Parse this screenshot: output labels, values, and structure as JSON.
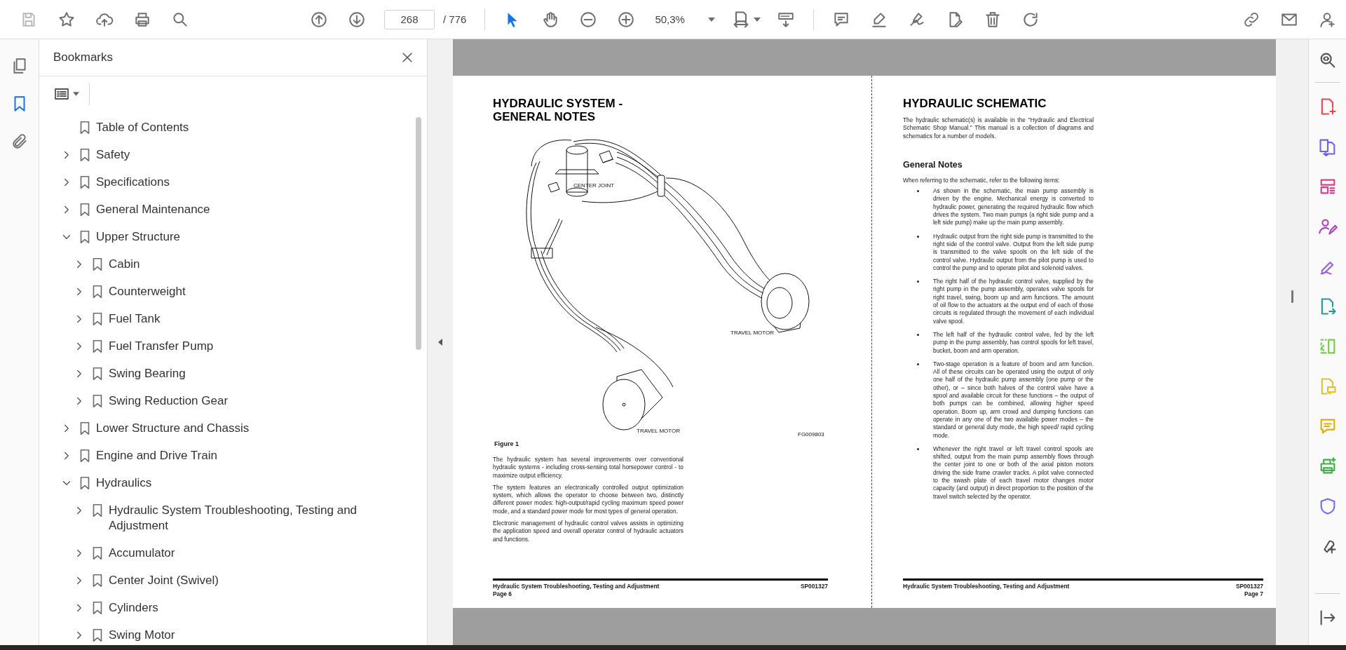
{
  "toolbar": {
    "save_disabled": true,
    "page_number": "268",
    "page_count": "/ 776",
    "zoom": "50,3%",
    "tools": [
      {
        "selected": true
      },
      {
        "selected": false
      }
    ]
  },
  "nav_rail": [
    {
      "selected": false
    },
    {
      "selected": true
    },
    {
      "selected": false
    }
  ],
  "bookmarks": {
    "title": "Bookmarks",
    "items": [
      {
        "label": "Table of Contents"
      },
      {
        "label": "Safety",
        "expanded": false
      },
      {
        "label": "Specifications",
        "expanded": false
      },
      {
        "label": "General Maintenance",
        "expanded": false
      },
      {
        "label": "Upper Structure",
        "expanded": true,
        "children": [
          {
            "label": "Cabin",
            "expanded": false
          },
          {
            "label": "Counterweight",
            "expanded": false
          },
          {
            "label": "Fuel Tank",
            "expanded": false
          },
          {
            "label": "Fuel Transfer Pump",
            "expanded": false
          },
          {
            "label": "Swing Bearing",
            "expanded": false
          },
          {
            "label": "Swing Reduction Gear",
            "expanded": false
          }
        ]
      },
      {
        "label": "Lower Structure and Chassis",
        "expanded": false
      },
      {
        "label": "Engine and Drive Train",
        "expanded": false
      },
      {
        "label": "Hydraulics",
        "expanded": true,
        "children": [
          {
            "label": "Hydraulic System Troubleshooting, Testing and Adjustment",
            "expanded": false
          },
          {
            "label": "Accumulator",
            "expanded": false
          },
          {
            "label": "Center Joint (Swivel)",
            "expanded": false
          },
          {
            "label": "Cylinders",
            "expanded": false
          },
          {
            "label": "Swing Motor",
            "expanded": false
          }
        ]
      }
    ]
  },
  "document": {
    "pages": [
      {
        "heading": "HYDRAULIC SYSTEM - GENERAL NOTES",
        "figure": {
          "labels": [
            "CENTER JOINT",
            "TRAVEL MOTOR",
            "TRAVEL MOTOR"
          ],
          "code": "FG009803",
          "caption": "Figure 1"
        },
        "paragraphs": [
          "The hydraulic system has several improvements over conventional hydraulic systems - including cross-sensing total horsepower control - to maximize output efficiency.",
          "The system features an electronically controlled output optimization system, which allows the operator to choose between two, distinctly different power modes: high-output/rapid cycling maximum speed power mode, and a standard power mode for most types of general operation.",
          "Electronic management of hydraulic control valves assists in optimizing the application speed and overall operator control of hydraulic actuators and functions."
        ],
        "footer_title": "Hydraulic System Troubleshooting, Testing and Adjustment",
        "footer_code": "SP001327",
        "page_label": "Page 6"
      },
      {
        "heading": "HYDRAULIC SCHEMATIC",
        "paragraphs": [
          "The hydraulic schematic(s) is available in the \"Hydraulic and Electrical Schematic Shop Manual.\" This manual is a collection of diagrams and schematics for a number of models."
        ],
        "subheading": "General Notes",
        "lead": "When referring to the schematic, refer to the following items:",
        "bullets": [
          "As shown in the schematic, the main pump assembly is driven by the engine. Mechanical energy is converted to hydraulic power, generating the required hydraulic flow which drives the system. Two main pumps (a right side pump and a left side pump) make up the main pump assembly.",
          "Hydraulic output from the right side pump is transmitted to the right side of the control valve. Output from the left side pump is transmitted to the valve spools on the left side of the control valve. Hydraulic output from the pilot pump is used to control the pump and to operate pilot and solenoid valves.",
          "The right half of the hydraulic control valve, supplied by the right pump in the pump assembly, operates valve spools for right travel, swing, boom up and arm functions. The amount of oil flow to the actuators at the output end of each of those circuits is regulated through the movement of each individual valve spool.",
          "The left half of the hydraulic control valve, fed by the left pump in the pump assembly, has control spools for left travel, bucket, boom and arm operation.",
          "Two-stage operation is a feature of boom and arm function. All of these circuits can be operated using the output of only one half of the hydraulic pump assembly (one pump or the other), or – since both halves of the control valve have a spool and available circuit for these functions – the output of both pumps can be combined, allowing higher speed operation. Boom up, arm crowd and dumping functions can operate in any one of the two available power modes – the standard or general duty mode, the high speed/ rapid cycling mode.",
          "Whenever the right travel or left travel control spools are shifted, output from the main pump assembly flows through the center joint to one or both of the axial piston motors driving the side frame crawler tracks. A pilot valve connected to the swash plate of each travel motor changes motor capacity (and output) in direct proportion to the position of the travel switch selected by the operator."
        ],
        "footer_title": "Hydraulic System Troubleshooting, Testing and Adjustment",
        "footer_code": "SP001327",
        "page_label": "Page 7"
      }
    ]
  }
}
